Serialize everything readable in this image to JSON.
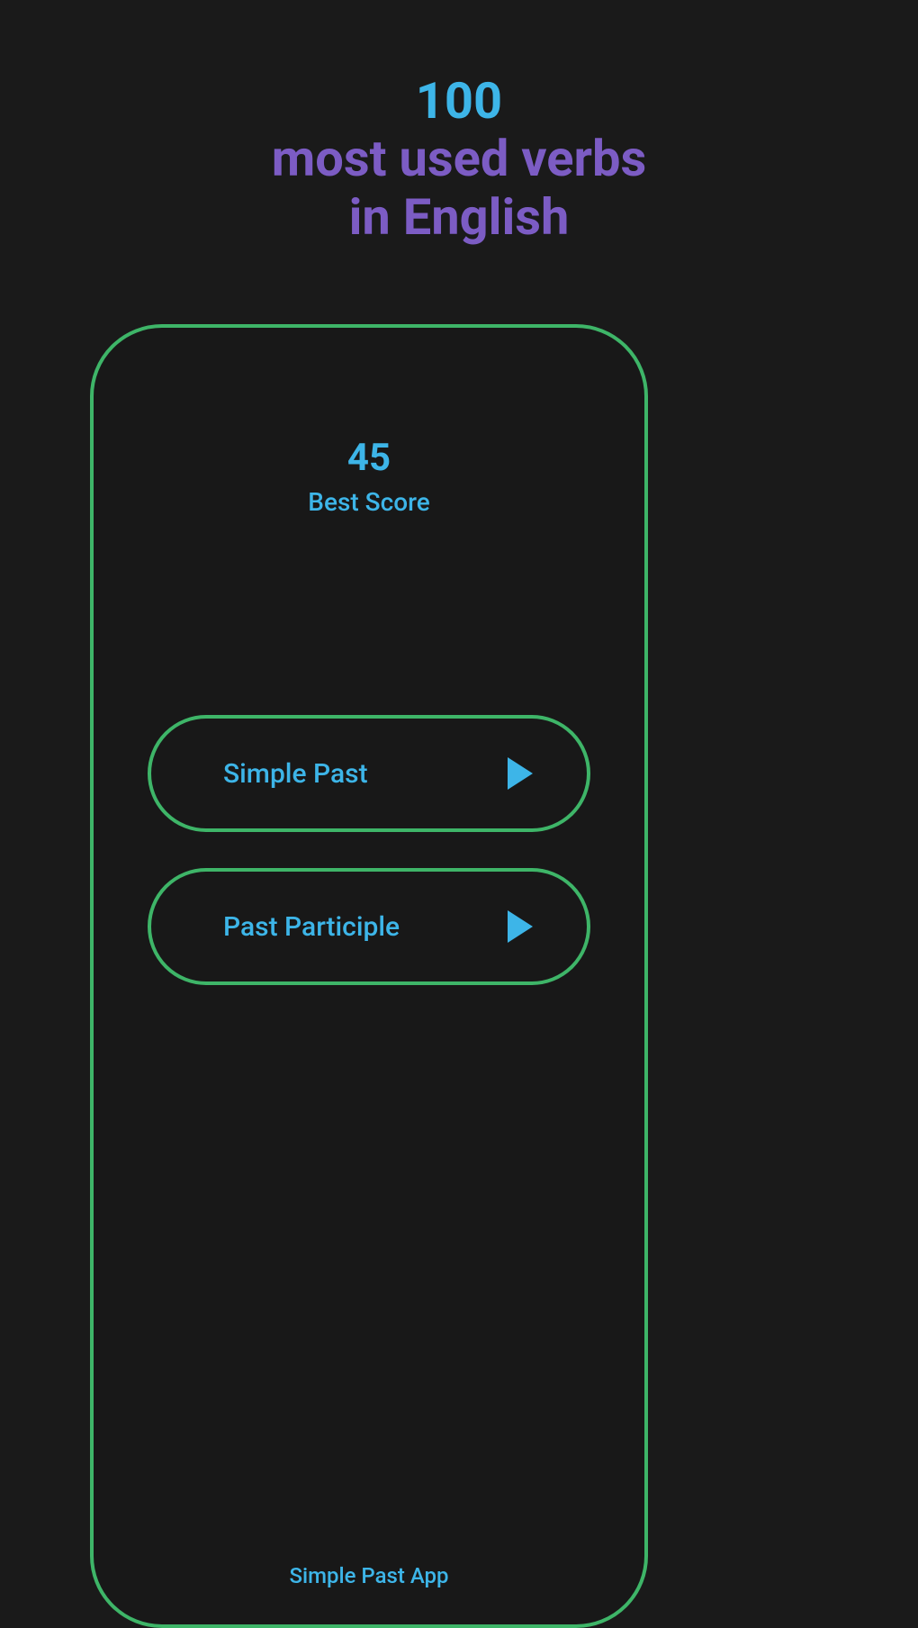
{
  "hero": {
    "line1": "100",
    "line2": "most used verbs",
    "line3": "in English"
  },
  "score": {
    "value": "45",
    "label": "Best Score"
  },
  "buttons": {
    "simple_past_label": "Simple Past",
    "past_participle_label": "Past Participle"
  },
  "footer": {
    "app_name": "Simple Past App"
  },
  "colors": {
    "background": "#1a1a1a",
    "accent_blue": "#3db5e8",
    "accent_purple": "#7c5cc4",
    "accent_green": "#3eb568"
  }
}
